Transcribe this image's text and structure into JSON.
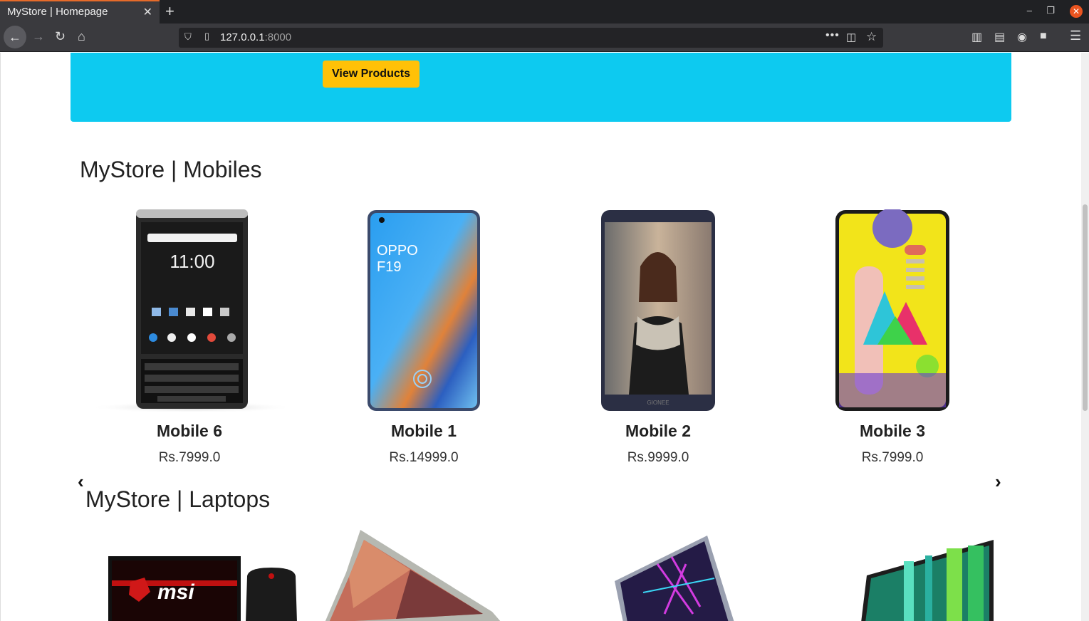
{
  "browser": {
    "tab_title": "MyStore | Homepage",
    "url_host": "127.0.0.1",
    "url_port": ":8000"
  },
  "hero": {
    "button_label": "View Products"
  },
  "mobiles": {
    "title": "MyStore | Mobiles",
    "items": [
      {
        "name": "Mobile 6",
        "price": "Rs.7999.0"
      },
      {
        "name": "Mobile 1",
        "price": "Rs.14999.0"
      },
      {
        "name": "Mobile 2",
        "price": "Rs.9999.0"
      },
      {
        "name": "Mobile 3",
        "price": "Rs.7999.0"
      }
    ],
    "prev_label": "‹",
    "next_label": "›"
  },
  "laptops": {
    "title": "MyStore | Laptops"
  },
  "phone_texts": {
    "clock": "11:00",
    "oppo_brand": "OPPO",
    "oppo_model": "F19",
    "gionee_brand": "GIONEE"
  },
  "laptop_texts": {
    "msi_brand": "msi"
  }
}
